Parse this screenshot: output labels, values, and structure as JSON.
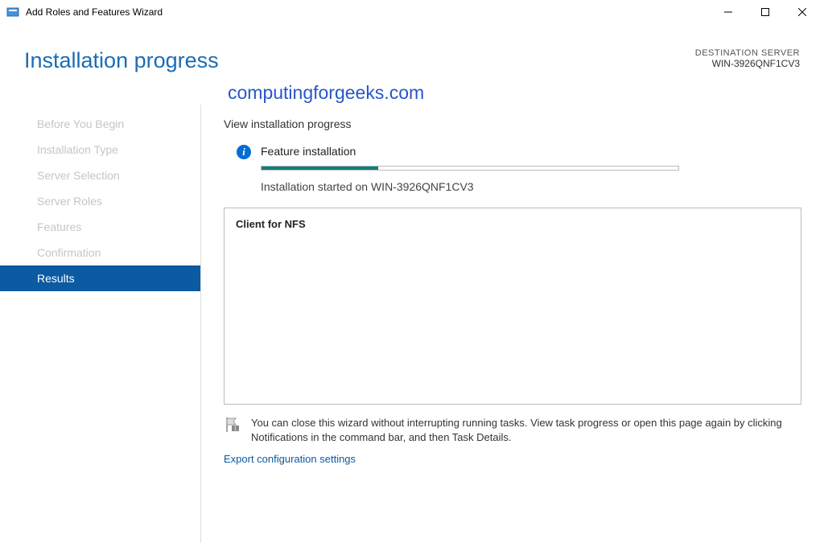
{
  "window": {
    "title": "Add Roles and Features Wizard"
  },
  "header": {
    "page_title": "Installation progress",
    "destination_label": "DESTINATION SERVER",
    "destination_server": "WIN-3926QNF1CV3"
  },
  "watermark": "computingforgeeks.com",
  "sidebar": {
    "items": [
      {
        "label": "Before You Begin",
        "active": false
      },
      {
        "label": "Installation Type",
        "active": false
      },
      {
        "label": "Server Selection",
        "active": false
      },
      {
        "label": "Server Roles",
        "active": false
      },
      {
        "label": "Features",
        "active": false
      },
      {
        "label": "Confirmation",
        "active": false
      },
      {
        "label": "Results",
        "active": true
      }
    ]
  },
  "content": {
    "section_header": "View installation progress",
    "feature_label": "Feature installation",
    "progress_status": "Installation started on WIN-3926QNF1CV3",
    "result_item": "Client for NFS",
    "note_text": "You can close this wizard without interrupting running tasks. View task progress or open this page again by clicking Notifications in the command bar, and then Task Details.",
    "export_link": "Export configuration settings"
  }
}
